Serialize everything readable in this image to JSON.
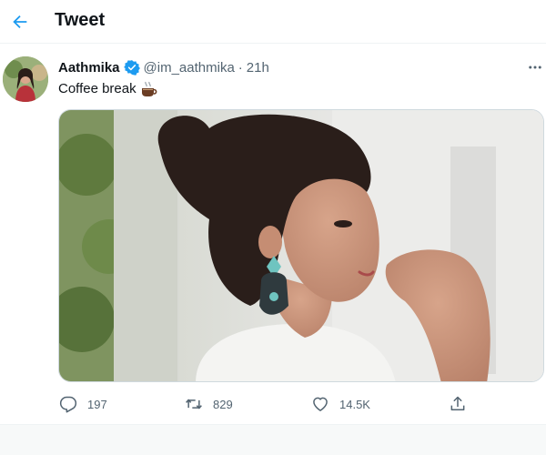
{
  "header": {
    "title": "Tweet",
    "back_icon": "arrow-left-icon"
  },
  "colors": {
    "accent": "#1d9bf0",
    "text_primary": "#0f1419",
    "text_secondary": "#536471",
    "border": "#eff3f4",
    "verified": "#1d9bf0"
  },
  "tweet": {
    "author_name": "Aathmika",
    "handle": "@im_aathmika",
    "separator": "·",
    "time": "21h",
    "text": "Coffee break",
    "emoji_icon": "coffee-icon",
    "more_icon": "more-horizontal-icon"
  },
  "actions": {
    "replies": "197",
    "retweets": "829",
    "likes": "14.5K",
    "reply_icon": "reply-icon",
    "retweet_icon": "retweet-icon",
    "like_icon": "heart-icon",
    "share_icon": "share-icon"
  }
}
